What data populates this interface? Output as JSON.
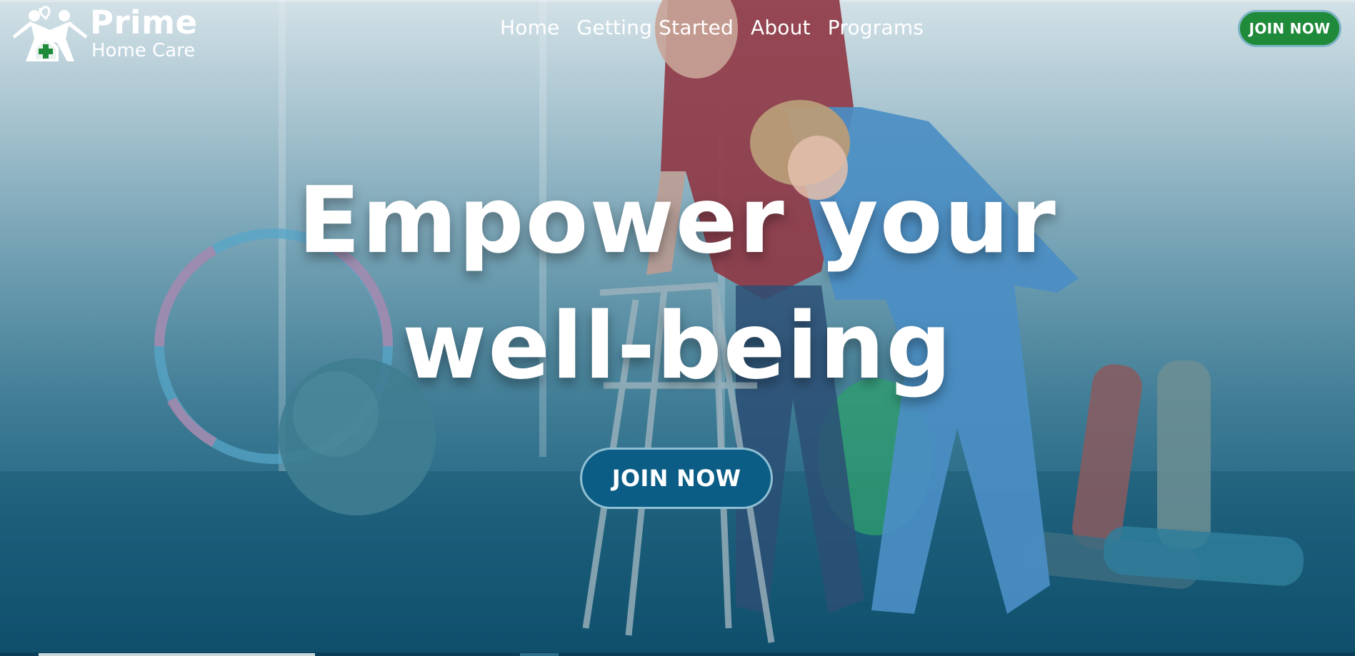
{
  "brand": {
    "name_line1": "Prime",
    "name_line2": "Home Care",
    "icon": "people-house-cross-logo"
  },
  "nav": {
    "items": [
      {
        "label": "Home"
      },
      {
        "label": "Getting Started"
      },
      {
        "label": "About"
      },
      {
        "label": "Programs"
      }
    ]
  },
  "header": {
    "cta_label": "JOIN NOW"
  },
  "hero": {
    "headline_line1": "Empower your",
    "headline_line2": "well-being",
    "cta_label": "JOIN NOW",
    "background_image": "caregiver-helping-senior-with-walker"
  },
  "colors": {
    "header_cta": "#1f8a3a",
    "hero_cta": "#0b5d86",
    "overlay_bottom": "#0e4e6d",
    "overlay_top": "#d3e1e7",
    "text": "#ffffff"
  }
}
